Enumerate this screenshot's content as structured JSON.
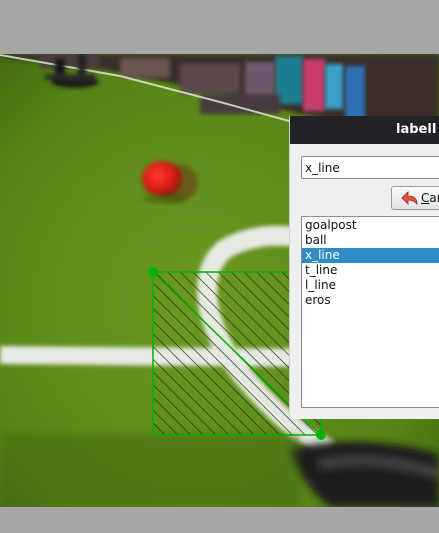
{
  "dialog": {
    "title": "labelI",
    "label_input_value": "x_line",
    "cancel_label": "Can",
    "labels": [
      "goalpost",
      "ball",
      "x_line",
      "t_line",
      "l_line",
      "eros"
    ],
    "selected_label": "x_line"
  },
  "annotation": {
    "shape_color": "#00b300",
    "hatch_color": "#1e2a10"
  }
}
